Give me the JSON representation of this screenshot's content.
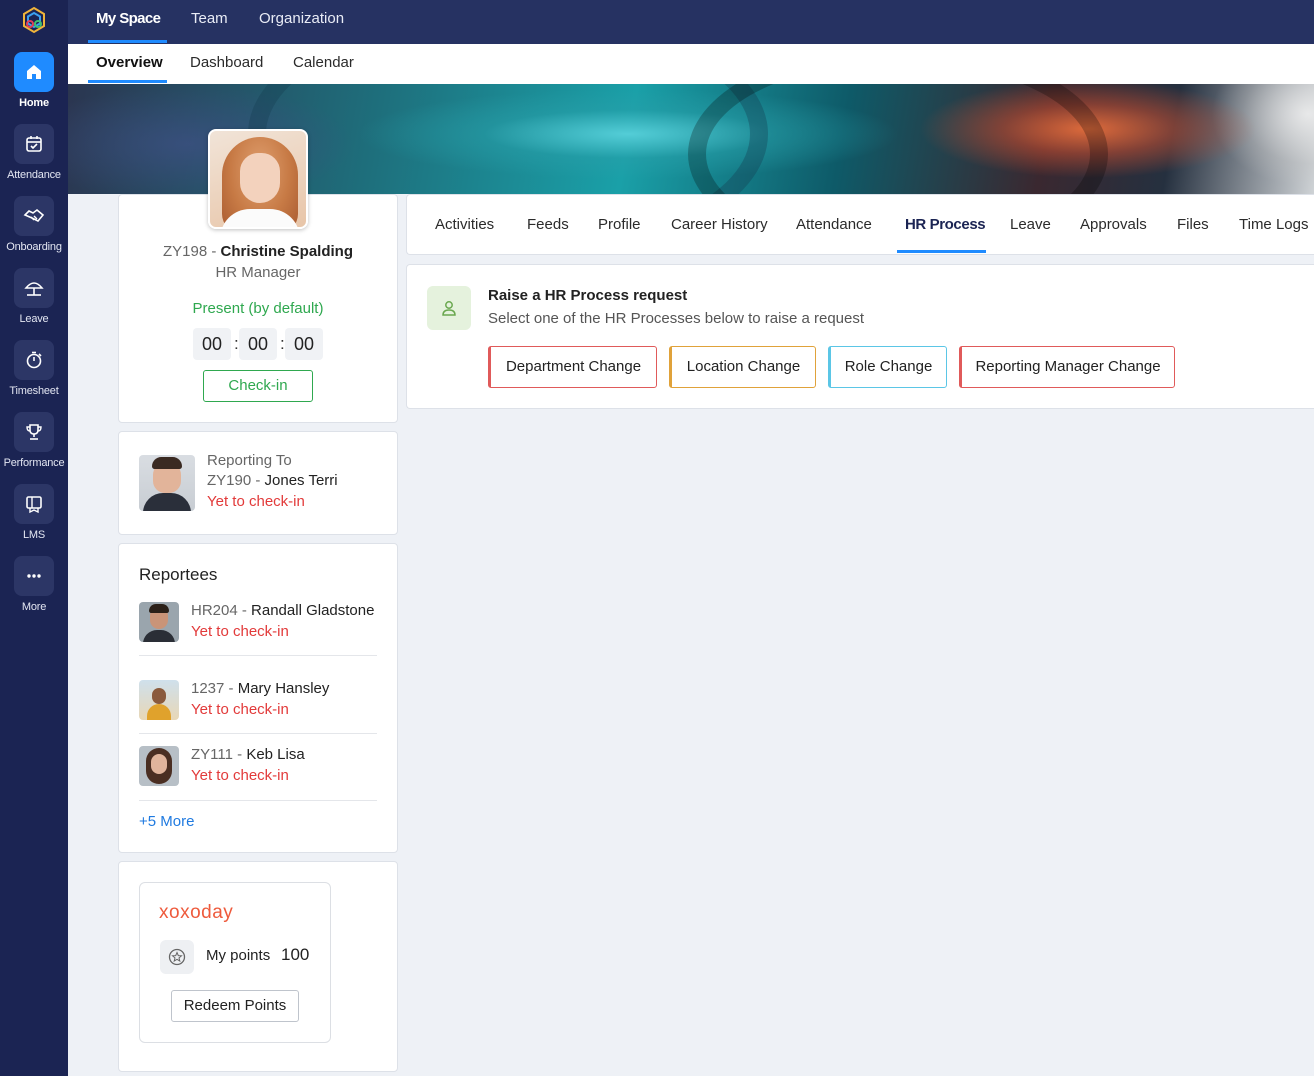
{
  "sidebar": {
    "items": [
      {
        "label": "Home",
        "icon": "home-icon",
        "active": true
      },
      {
        "label": "Attendance",
        "icon": "calendar-check-icon"
      },
      {
        "label": "Onboarding",
        "icon": "handshake-icon"
      },
      {
        "label": "Leave",
        "icon": "umbrella-icon"
      },
      {
        "label": "Timesheet",
        "icon": "stopwatch-icon"
      },
      {
        "label": "Performance",
        "icon": "trophy-icon"
      },
      {
        "label": "LMS",
        "icon": "book-icon"
      },
      {
        "label": "More",
        "icon": "more-dots-icon"
      }
    ]
  },
  "top_nav": {
    "tabs": [
      {
        "label": "My Space",
        "active": true
      },
      {
        "label": "Team"
      },
      {
        "label": "Organization"
      }
    ]
  },
  "sub_nav": {
    "tabs": [
      {
        "label": "Overview",
        "active": true
      },
      {
        "label": "Dashboard"
      },
      {
        "label": "Calendar"
      }
    ]
  },
  "profile": {
    "emp_id": "ZY198 - ",
    "name": "Christine Spalding",
    "designation": "HR Manager",
    "status": "Present (by default)",
    "timer": {
      "hh": "00",
      "mm": "00",
      "ss": "00"
    },
    "checkin_label": "Check-in"
  },
  "reporting_to": {
    "label": "Reporting To",
    "emp_id": "ZY190 - ",
    "name": "Jones Terri",
    "status": "Yet to check-in"
  },
  "reportees": {
    "title": "Reportees",
    "items": [
      {
        "emp_id": "HR204 - ",
        "name": "Randall Gladstone",
        "status": "Yet to check-in"
      },
      {
        "emp_id": "1237 - ",
        "name": "Mary Hansley",
        "status": "Yet to check-in"
      },
      {
        "emp_id": "ZY111 - ",
        "name": "Keb Lisa",
        "status": "Yet to check-in"
      }
    ],
    "more_label": "+5 More"
  },
  "rewards": {
    "brand": "xoxoday",
    "points_label": "My points",
    "points_value": "100",
    "redeem_label": "Redeem Points"
  },
  "profile_tabs": {
    "items": [
      {
        "label": "Activities"
      },
      {
        "label": "Feeds"
      },
      {
        "label": "Profile"
      },
      {
        "label": "Career History"
      },
      {
        "label": "Attendance"
      },
      {
        "label": "HR Process",
        "active": true
      },
      {
        "label": "Leave"
      },
      {
        "label": "Approvals"
      },
      {
        "label": "Files"
      },
      {
        "label": "Time Logs"
      }
    ]
  },
  "hr_process": {
    "title": "Raise a HR Process request",
    "subtitle": "Select one of the HR Processes below to raise a request",
    "buttons": [
      {
        "label": "Department Change",
        "color": "#e05a5a"
      },
      {
        "label": "Location Change",
        "color": "#e0a23a"
      },
      {
        "label": "Role Change",
        "color": "#5bc6e6"
      },
      {
        "label": "Reporting Manager Change",
        "color": "#e05a5a"
      }
    ]
  },
  "colors": {
    "sidebar_bg": "#1b2453",
    "topbar_bg": "#263262",
    "accent": "#1f8bff",
    "present_green": "#2fa84f",
    "alert_red": "#e23a3a",
    "link_blue": "#1f7ae0"
  }
}
